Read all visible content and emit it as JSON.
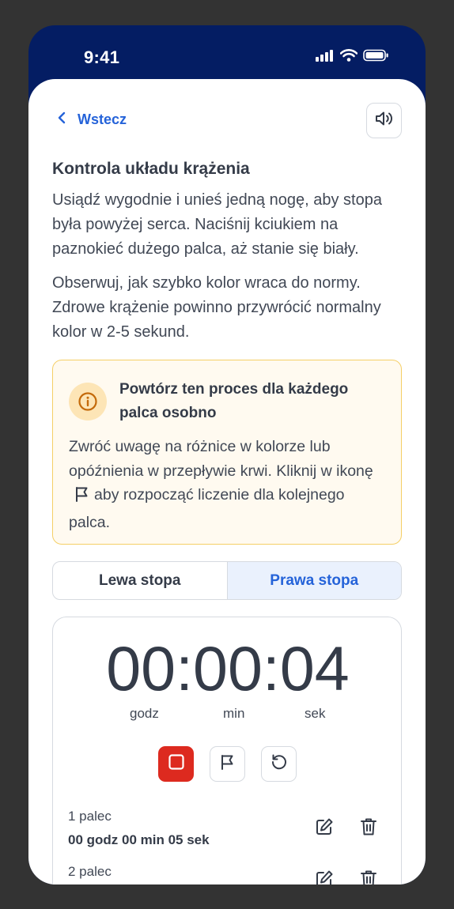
{
  "status_bar": {
    "time": "9:41",
    "icons": [
      "signal-icon",
      "wifi-icon",
      "battery-icon"
    ]
  },
  "header": {
    "back_label": "Wstecz",
    "audio_icon": "speaker-icon"
  },
  "content": {
    "title": "Kontrola układu krążenia",
    "paragraph1": "Usiądź wygodnie i unieś jedną nogę, aby stopa była powyżej serca. Naciśnij kciukiem na paznokieć dużego palca, aż stanie się biały.",
    "paragraph2": "Obserwuj, jak szybko kolor wraca do normy. Zdrowe krążenie powinno przywrócić normalny kolor w 2-5 sekund."
  },
  "alert": {
    "icon": "info-icon",
    "title": "Powtórz ten proces dla każdego palca osobno",
    "body_before_icon": "Zwróć uwagę na różnice w kolorze lub opóźnienia w przepływie krwi. Kliknij w ikonę",
    "body_after_icon": "aby rozpocząć liczenie dla kolejnego palca."
  },
  "tabs": {
    "left": "Lewa stopa",
    "right": "Prawa stopa",
    "selected": "right"
  },
  "timer": {
    "display": "00:00:04",
    "units": {
      "hours": "godz",
      "minutes": "min",
      "seconds": "sek"
    }
  },
  "laps": [
    {
      "label": "1 palec",
      "value": "00 godz 00 min 05 sek"
    },
    {
      "label": "2 palec",
      "value": ""
    }
  ],
  "colors": {
    "navy": "#041d63",
    "accent_blue": "#2563d9",
    "stop_red": "#dd2a1f",
    "alert_bg": "#fffaf0",
    "alert_border": "#f5cf66",
    "alert_icon": "#c46a0a"
  }
}
